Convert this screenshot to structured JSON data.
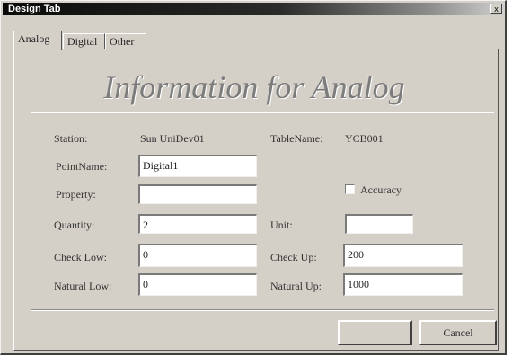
{
  "window": {
    "title": "Design Tab",
    "close_glyph": "x"
  },
  "tabs": [
    {
      "label": "Analog",
      "active": true
    },
    {
      "label": "Digital",
      "active": false
    },
    {
      "label": "Other",
      "active": false
    }
  ],
  "heading": "Information for Analog",
  "fields": {
    "station": {
      "label": "Station:",
      "value": "Sun UniDev01"
    },
    "table_name": {
      "label": "TableName:",
      "value": "YCB001"
    },
    "point_name": {
      "label": "PointName:",
      "value": "Digital1"
    },
    "property": {
      "label": "Property:",
      "value": ""
    },
    "quantity": {
      "label": "Quantity:",
      "value": "2"
    },
    "unit": {
      "label": "Unit:",
      "value": ""
    },
    "check_low": {
      "label": "Check Low:",
      "value": "0"
    },
    "check_up": {
      "label": "Check Up:",
      "value": "200"
    },
    "natural_low": {
      "label": "Natural Low:",
      "value": "0"
    },
    "natural_up": {
      "label": "Natural Up:",
      "value": "1000"
    }
  },
  "accuracy_checkbox": {
    "label": "Accuracy",
    "checked": false
  },
  "buttons": {
    "ok": "",
    "cancel": "Cancel"
  }
}
